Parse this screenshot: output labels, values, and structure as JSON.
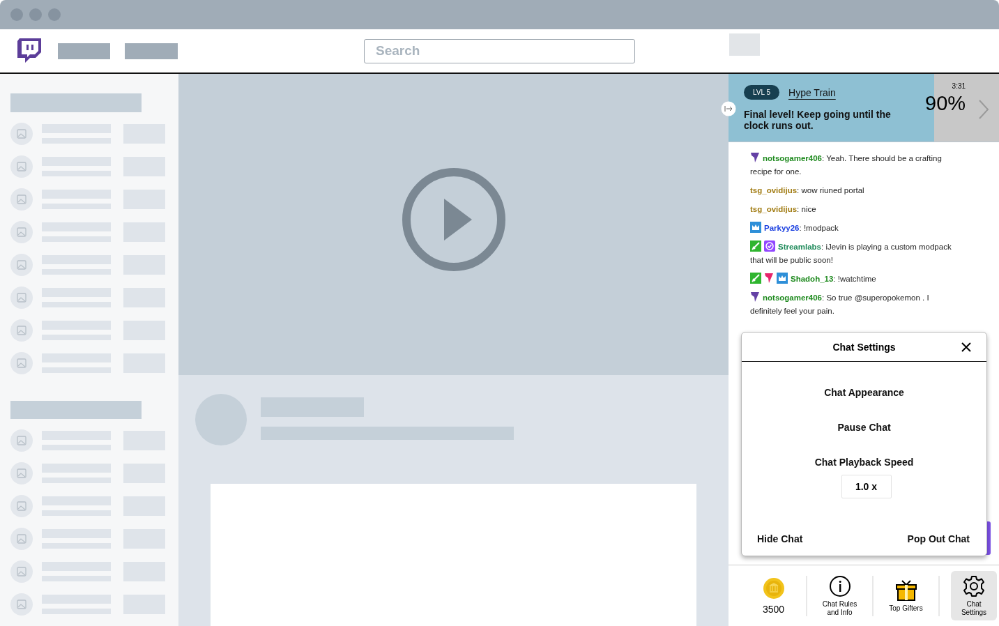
{
  "header": {
    "search": {
      "placeholder": "Search"
    }
  },
  "hype_train": {
    "level_badge": "LVL 5",
    "title": "Hype Train",
    "message": "Final level! Keep going until the clock runs out.",
    "timer": "3:31",
    "percent": "90%",
    "level": 0.76
  },
  "chat_messages": [
    {
      "badges": [
        {
          "kind": "chevron",
          "color": "#6441a5"
        }
      ],
      "user": "notsogamer406",
      "color": "#1e8a1e",
      "text": ": Yeah. There should be a crafting recipe for one."
    },
    {
      "user": "tsg_ovidijus",
      "color": "#a07a10",
      "text": ": wow riuned portal"
    },
    {
      "user": "tsg_ovidijus",
      "color": "#a07a10",
      "text": ": nice"
    },
    {
      "badges": [
        {
          "kind": "crown",
          "color": "#2e8fd8"
        }
      ],
      "user": "Parkyy26",
      "color": "#1a3fe0",
      "text": ": !modpack"
    },
    {
      "badges": [
        {
          "kind": "sword",
          "color": "#2fb52f"
        },
        {
          "kind": "verified",
          "color": "#9147ff"
        }
      ],
      "user": "Streamlabs",
      "color": "#1e8a5a",
      "text": ": iJevin is playing a custom modpack that will be public soon!"
    },
    {
      "badges": [
        {
          "kind": "sword",
          "color": "#2fb52f"
        },
        {
          "kind": "chevron",
          "color": "#e6246b"
        },
        {
          "kind": "crown",
          "color": "#2e8fd8"
        }
      ],
      "user": "Shadoh_13",
      "color": "#1e8a1e",
      "text": ": !watchtime"
    },
    {
      "badges": [
        {
          "kind": "chevron",
          "color": "#6441a5"
        }
      ],
      "user": "notsogamer406",
      "color": "#1e8a1e",
      "text": ": So true @superopokemon . I definitely feel your pain."
    }
  ],
  "chat_settings": {
    "title": "Chat Settings",
    "options": [
      "Chat Appearance",
      "Pause Chat"
    ],
    "speed_label": "Chat Playback Speed",
    "speed_value": "1.0 x",
    "footer": [
      "Hide Chat",
      "Pop Out Chat"
    ]
  },
  "bottom_bar": [
    {
      "kind": "coin",
      "label": "3500",
      "selected": false
    },
    {
      "kind": "info",
      "label": "Chat Rules and Info",
      "selected": false
    },
    {
      "kind": "gift",
      "label": "Top Gifters",
      "selected": false
    },
    {
      "kind": "gear",
      "label": "Chat Settings",
      "selected": true
    }
  ]
}
